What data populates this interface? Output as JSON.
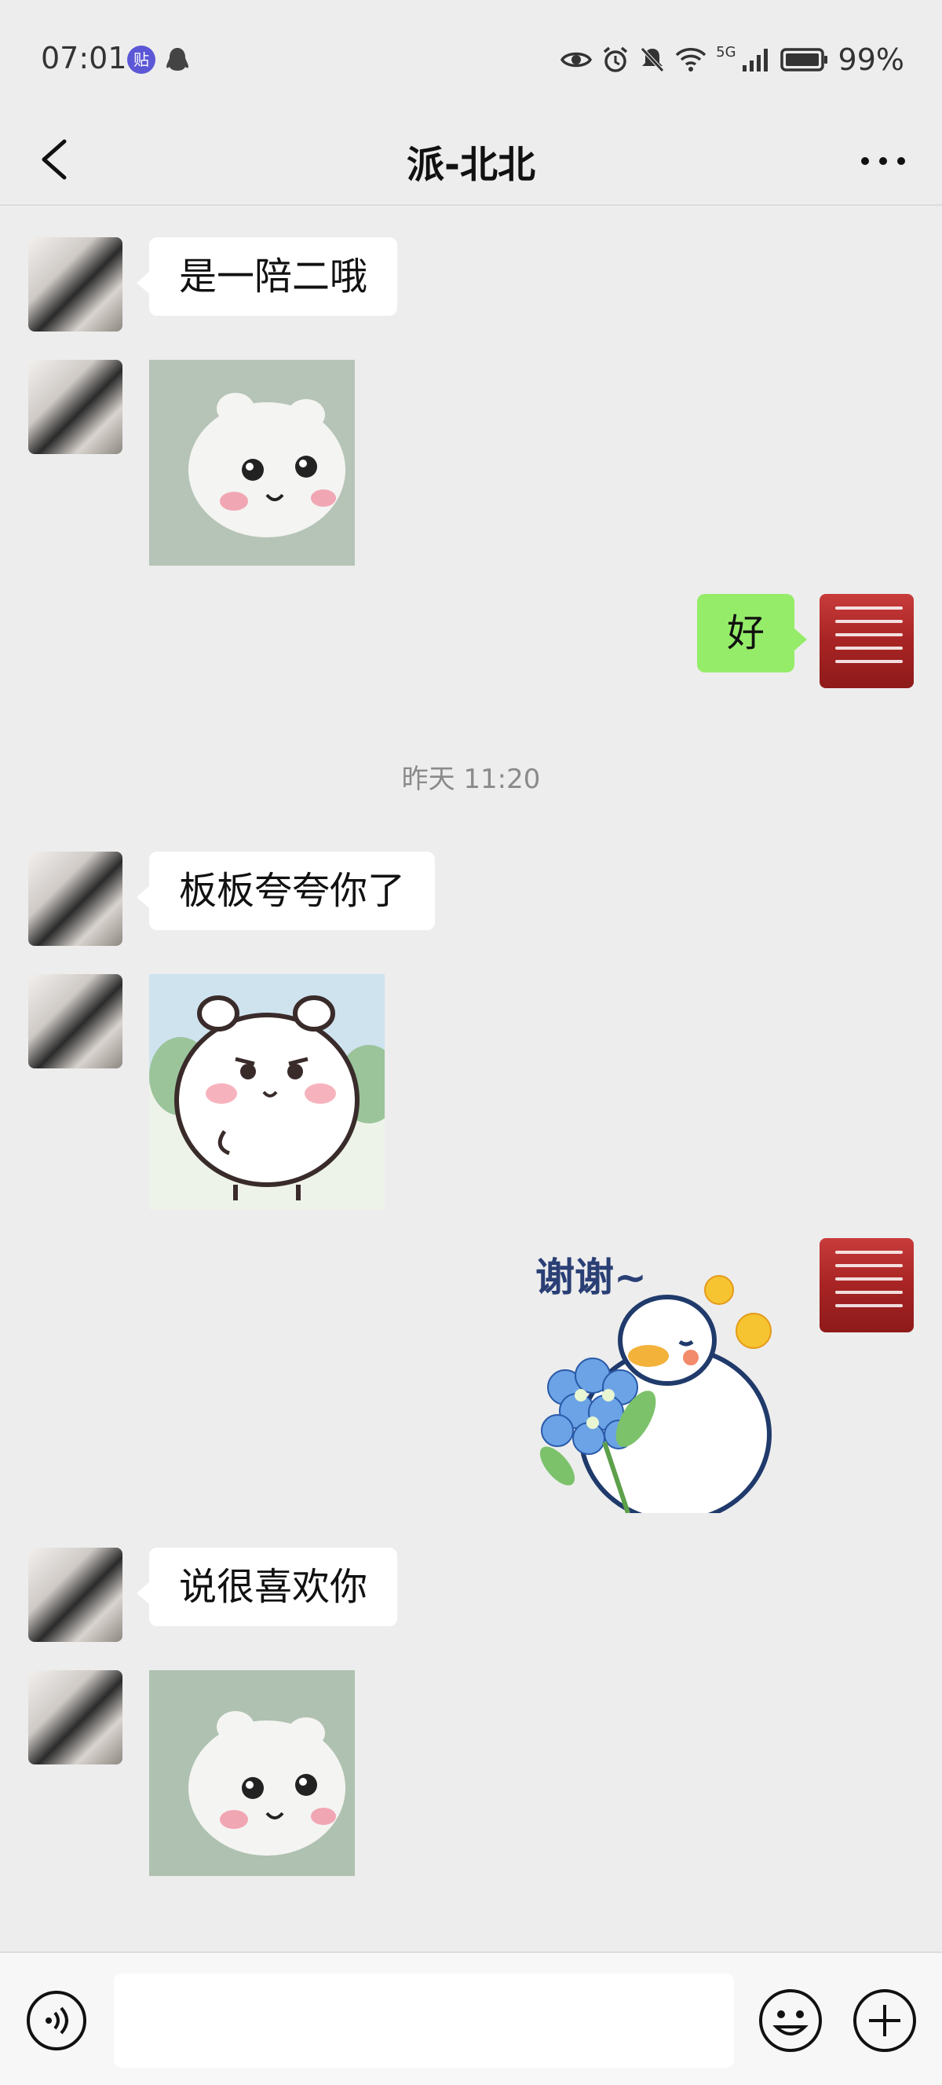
{
  "status": {
    "time": "07:01",
    "app_badge": "贴",
    "network": "5G",
    "battery": "99%"
  },
  "nav": {
    "title": "派-北北"
  },
  "messages": [
    {
      "side": "left",
      "type": "text",
      "text": "是一陪二哦"
    },
    {
      "side": "left",
      "type": "sticker",
      "sticker": "white-bear-peeking-sticker"
    },
    {
      "side": "right",
      "type": "text",
      "text": "好"
    },
    {
      "type": "timestamp",
      "text": "昨天 11:20"
    },
    {
      "side": "left",
      "type": "text",
      "text": "板板夸夸你了"
    },
    {
      "side": "left",
      "type": "sticker",
      "sticker": "white-bear-standing-sticker"
    },
    {
      "side": "right",
      "type": "sticker",
      "sticker": "duck-flowers-sticker",
      "text": "谢谢~"
    },
    {
      "side": "left",
      "type": "text",
      "text": "说很喜欢你"
    },
    {
      "side": "left",
      "type": "sticker",
      "sticker": "white-bear-peeking-sticker"
    }
  ],
  "colors": {
    "background": "#ededed",
    "bubble_self": "#95ec69",
    "bubble_other": "#ffffff",
    "self_avatar": "#b22c2c"
  },
  "icons": {
    "back": "chevron-left-icon",
    "more": "more-dots-icon",
    "voice": "voice-icon",
    "emoji": "emoji-icon",
    "plus": "plus-icon"
  }
}
